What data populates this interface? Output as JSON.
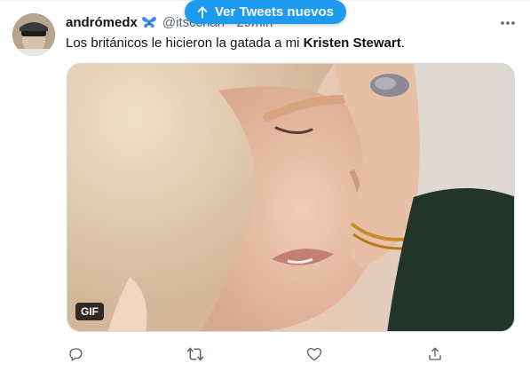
{
  "banner": {
    "label": "Ver Tweets nuevos",
    "icon": "arrow-up-icon"
  },
  "tweet": {
    "display_name": "andrómedx",
    "handle": "@itsccharl · 29min",
    "text_before": "Los británicos le hicieron la gatada a mi ",
    "text_bold": "Kristen Stewart",
    "text_after": ".",
    "media": {
      "badge": "GIF"
    }
  },
  "actions": [
    "reply-icon",
    "retweet-icon",
    "like-icon",
    "share-icon"
  ],
  "colors": {
    "accent": "#1d9bf0",
    "secondary_text": "#536471",
    "butterfly": "#3a8de6"
  }
}
